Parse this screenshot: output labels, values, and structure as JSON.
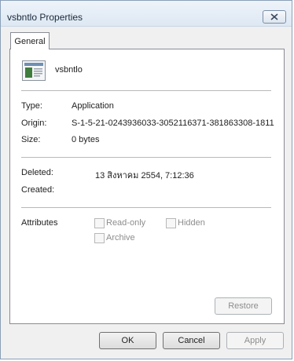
{
  "window": {
    "title": "vsbntlo Properties"
  },
  "icons": {
    "close": "close-icon",
    "file": "application-file-icon"
  },
  "tabs": [
    {
      "label": "General"
    }
  ],
  "file": {
    "name": "vsbntlo"
  },
  "info": {
    "type": {
      "label": "Type:",
      "value": "Application"
    },
    "origin": {
      "label": "Origin:",
      "value": "S-1-5-21-0243936033-3052116371-381863308-1811"
    },
    "size": {
      "label": "Size:",
      "value": "0 bytes"
    }
  },
  "dates": {
    "deleted": {
      "label": "Deleted:",
      "value": "13 สิงหาคม 2554, 7:12:36"
    },
    "created": {
      "label": "Created:",
      "value": ""
    }
  },
  "attributes": {
    "label": "Attributes",
    "read_only": {
      "label": "Read-only",
      "checked": false
    },
    "hidden": {
      "label": "Hidden",
      "checked": false
    },
    "archive": {
      "label": "Archive",
      "checked": false
    }
  },
  "buttons": {
    "restore": "Restore",
    "ok": "OK",
    "cancel": "Cancel",
    "apply": "Apply"
  }
}
